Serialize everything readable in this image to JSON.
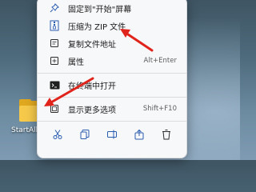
{
  "desktop": {
    "icon_label": "StartAllB"
  },
  "menu": {
    "items": [
      {
        "label": "固定到\"开始\"屏幕",
        "shortcut": ""
      },
      {
        "label": "压缩为 ZIP 文件",
        "shortcut": ""
      },
      {
        "label": "复制文件地址",
        "shortcut": ""
      },
      {
        "label": "属性",
        "shortcut": "Alt+Enter"
      },
      {
        "label": "在终端中打开",
        "shortcut": ""
      },
      {
        "label": "显示更多选项",
        "shortcut": "Shift+F10"
      }
    ],
    "actions": [
      "cut-icon",
      "copy-icon",
      "rename-icon",
      "share-icon",
      "delete-icon"
    ]
  },
  "colors": {
    "accent_arrow": "#e0241b",
    "folder": "#f6c94b"
  }
}
